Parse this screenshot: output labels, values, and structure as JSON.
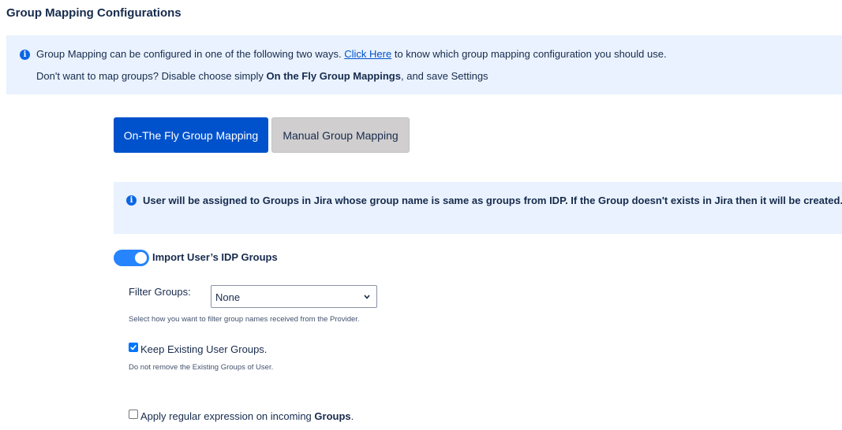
{
  "page": {
    "title": "Group Mapping Configurations"
  },
  "info_banner": {
    "line1_prefix": "Group Mapping can be configured in one of the following two ways.",
    "line1_link": "Click Here",
    "line1_suffix": "to know which group mapping configuration you should use.",
    "line2_prefix": "Don't want to map groups? Disable choose simply",
    "line2_bold": "On the Fly Group Mappings",
    "line2_suffix": ", and save Settings"
  },
  "mode_buttons": {
    "on_the_fly": "On-The Fly Group Mapping",
    "manual": "Manual Group Mapping"
  },
  "note": {
    "text": "User will be assigned to Groups in Jira whose group name is same as groups from IDP. If the Group doesn't exists in Jira then it will be created."
  },
  "import_toggle": {
    "label": "Import User’s IDP Groups",
    "enabled": true
  },
  "filter_groups": {
    "label": "Filter Groups:",
    "selected": "None",
    "hint": "Select how you want to filter group names received from the Provider."
  },
  "keep_existing": {
    "label": "Keep Existing User Groups.",
    "checked": true,
    "hint": "Do not remove the Existing Groups of User."
  },
  "regex": {
    "label_prefix": "Apply regular expression on incoming",
    "label_bold": "Groups",
    "label_suffix": ".",
    "checked": false
  },
  "colors": {
    "primary": "#0052cc",
    "secondary_button": "#d0cece",
    "banner_bg": "#e9f2fe",
    "toggle_on": "#2684ff"
  }
}
